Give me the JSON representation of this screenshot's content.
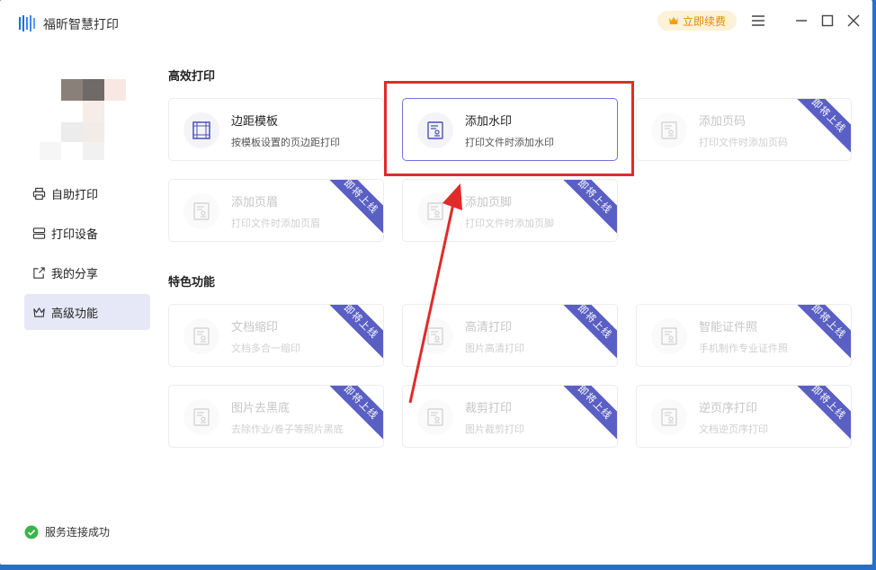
{
  "app": {
    "title": "福昕智慧打印"
  },
  "header": {
    "renew_label": "立即续费"
  },
  "sidebar": {
    "items": [
      {
        "label": "自助打印",
        "icon": "printer-icon"
      },
      {
        "label": "打印设备",
        "icon": "device-icon"
      },
      {
        "label": "我的分享",
        "icon": "share-icon"
      },
      {
        "label": "高级功能",
        "icon": "crown-icon",
        "active": true
      }
    ]
  },
  "status": {
    "text": "服务连接成功"
  },
  "sections": {
    "efficient": {
      "title": "高效打印",
      "cards": [
        {
          "title": "边距模板",
          "desc": "按模板设置的页边距打印",
          "badge": ""
        },
        {
          "title": "添加水印",
          "desc": "打印文件时添加水印",
          "badge": ""
        },
        {
          "title": "添加页码",
          "desc": "打印文件时添加页码",
          "badge": "即将上线"
        },
        {
          "title": "添加页眉",
          "desc": "打印文件时添加页眉",
          "badge": "即将上线"
        },
        {
          "title": "添加页脚",
          "desc": "打印文件时添加页脚",
          "badge": "即将上线"
        }
      ]
    },
    "special": {
      "title": "特色功能",
      "cards": [
        {
          "title": "文档缩印",
          "desc": "文档多合一缩印",
          "badge": "即将上线"
        },
        {
          "title": "高清打印",
          "desc": "图片高清打印",
          "badge": "即将上线"
        },
        {
          "title": "智能证件照",
          "desc": "手机制作专业证件照",
          "badge": "即将上线"
        },
        {
          "title": "图片去黑底",
          "desc": "去除作业/卷子等照片黑底",
          "badge": "即将上线"
        },
        {
          "title": "裁剪打印",
          "desc": "图片裁剪打印",
          "badge": "即将上线"
        },
        {
          "title": "逆页序打印",
          "desc": "文档逆页序打印",
          "badge": "即将上线"
        }
      ]
    }
  },
  "colors": {
    "accent": "#5a5fc4",
    "highlight": "#e02b2b",
    "renew": "#e08a00"
  }
}
